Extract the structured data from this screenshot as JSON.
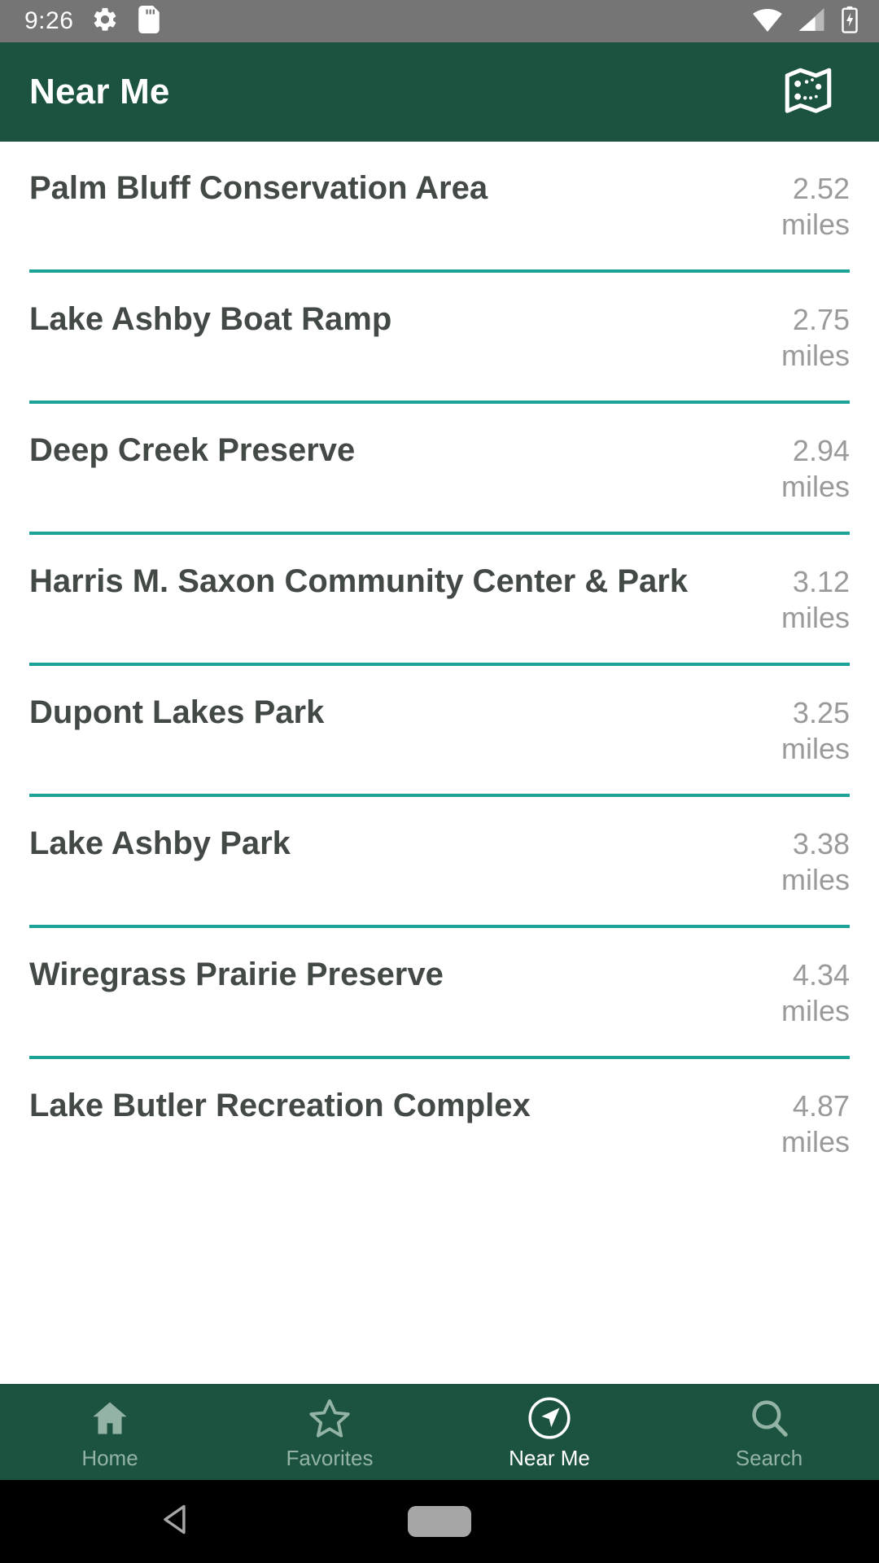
{
  "status_bar": {
    "time": "9:26",
    "left_icons": [
      "gear-icon",
      "sd-card-icon"
    ],
    "right_icons": [
      "wifi-icon",
      "cellular-signal-icon",
      "battery-charging-icon"
    ],
    "background": "#757575"
  },
  "app_bar": {
    "title": "Near Me",
    "action_icon": "map-icon",
    "background": "#1c5340"
  },
  "theme": {
    "primary_green": "#1c5340",
    "divider_teal": "#1aa396",
    "name_text": "#434a45",
    "distance_text": "#9a9a9a",
    "nav_inactive": "#93b3a5",
    "nav_active": "#ffffff"
  },
  "list": {
    "unit": "miles",
    "items": [
      {
        "name": "Palm Bluff Conservation Area",
        "distance": "2.52",
        "unit": "miles"
      },
      {
        "name": "Lake Ashby Boat Ramp",
        "distance": "2.75",
        "unit": "miles"
      },
      {
        "name": "Deep Creek Preserve",
        "distance": "2.94",
        "unit": "miles"
      },
      {
        "name": "Harris M. Saxon Community Center & Park",
        "distance": "3.12",
        "unit": "miles"
      },
      {
        "name": "Dupont Lakes Park",
        "distance": "3.25",
        "unit": "miles"
      },
      {
        "name": "Lake Ashby Park",
        "distance": "3.38",
        "unit": "miles"
      },
      {
        "name": "Wiregrass Prairie Preserve",
        "distance": "4.34",
        "unit": "miles"
      },
      {
        "name": "Lake Butler Recreation Complex",
        "distance": "4.87",
        "unit": "miles"
      }
    ]
  },
  "bottom_nav": {
    "items": [
      {
        "label": "Home",
        "icon": "home-icon",
        "active": false
      },
      {
        "label": "Favorites",
        "icon": "star-icon",
        "active": false
      },
      {
        "label": "Near Me",
        "icon": "navigation-arrow-icon",
        "active": true
      },
      {
        "label": "Search",
        "icon": "search-icon",
        "active": false
      }
    ]
  },
  "system_nav": {
    "back_icon": "back-triangle-icon",
    "home_icon": "home-pill-icon"
  }
}
